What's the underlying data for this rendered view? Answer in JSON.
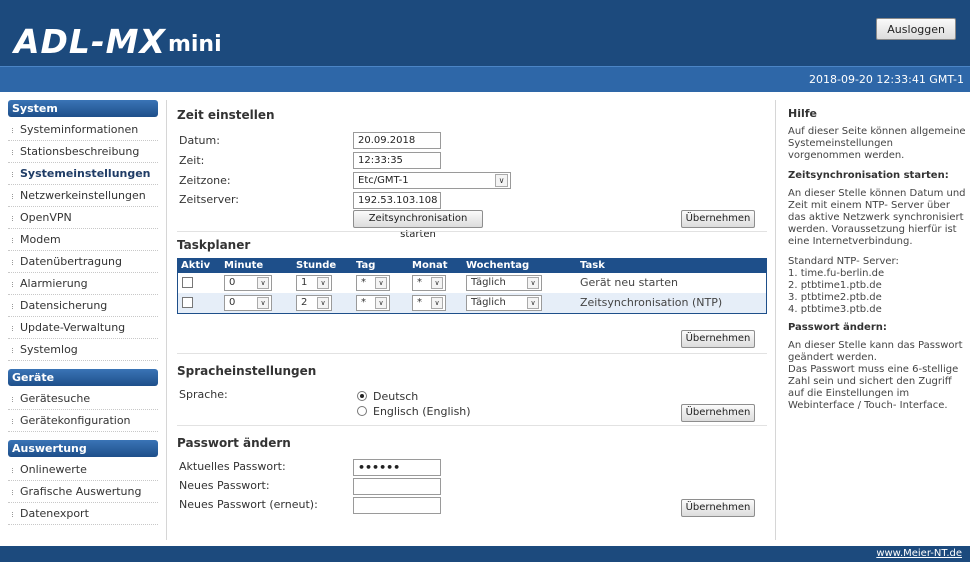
{
  "header": {
    "logo_main": "ADL-MX",
    "logo_sub": "mini",
    "logout_label": "Ausloggen",
    "datetime": "2018-09-20 12:33:41 GMT-1"
  },
  "sidebar": {
    "groups": [
      {
        "title": "System",
        "items": [
          "Systeminformationen",
          "Stationsbeschreibung",
          "Systemeinstellungen",
          "Netzwerkeinstellungen",
          "OpenVPN",
          "Modem",
          "Datenübertragung",
          "Alarmierung",
          "Datensicherung",
          "Update-Verwaltung",
          "Systemlog"
        ]
      },
      {
        "title": "Geräte",
        "items": [
          "Gerätesuche",
          "Gerätekonfiguration"
        ]
      },
      {
        "title": "Auswertung",
        "items": [
          "Onlinewerte",
          "Grafische Auswertung",
          "Datenexport"
        ]
      }
    ],
    "active_item": "Systemeinstellungen"
  },
  "time_section": {
    "title": "Zeit einstellen",
    "date_label": "Datum:",
    "date_value": "20.09.2018",
    "time_label": "Zeit:",
    "time_value": "12:33:35",
    "timezone_label": "Zeitzone:",
    "timezone_value": "Etc/GMT-1",
    "server_label": "Zeitserver:",
    "server_value": "192.53.103.108",
    "sync_button": "Zeitsynchronisation starten",
    "apply_button": "Übernehmen"
  },
  "task_section": {
    "title": "Taskplaner",
    "columns": [
      "Aktiv",
      "Minute",
      "Stunde",
      "Tag",
      "Monat",
      "Wochentag",
      "Task"
    ],
    "rows": [
      {
        "minute": "0",
        "hour": "1",
        "day": "*",
        "month": "*",
        "weekday": "Täglich",
        "task": "Gerät neu starten"
      },
      {
        "minute": "0",
        "hour": "2",
        "day": "*",
        "month": "*",
        "weekday": "Täglich",
        "task": "Zeitsynchronisation (NTP)"
      }
    ],
    "apply_button": "Übernehmen"
  },
  "lang_section": {
    "title": "Spracheinstellungen",
    "label": "Sprache:",
    "options": [
      "Deutsch",
      "Englisch (English)"
    ],
    "selected": "Deutsch",
    "apply_button": "Übernehmen"
  },
  "pw_section": {
    "title": "Passwort ändern",
    "current_label": "Aktuelles Passwort:",
    "current_value": "••••••",
    "new_label": "Neues Passwort:",
    "repeat_label": "Neues Passwort (erneut):",
    "apply_button": "Übernehmen"
  },
  "help": {
    "title": "Hilfe",
    "intro": "Auf dieser Seite können allgemeine Systemeinstellungen vorgenommen werden.",
    "sync_title": "Zeitsynchronisation starten:",
    "sync_text": "An dieser Stelle können Datum und Zeit mit einem NTP- Server über das aktive Netzwerk synchronisiert werden. Voraussetzung hierfür ist eine Internetverbindung.",
    "ntp_heading": "Standard NTP- Server:",
    "ntp_servers": [
      "1. time.fu-berlin.de",
      "2. ptbtime1.ptb.de",
      "3. ptbtime2.ptb.de",
      "4. ptbtime3.ptb.de"
    ],
    "pw_title": "Passwort ändern:",
    "pw_text": "An dieser Stelle kann das Passwort geändert werden.",
    "pw_text2": "Das Passwort muss eine 6-stellige Zahl sein und sichert den Zugriff auf die Einstellungen im Webinterface / Touch- Interface."
  },
  "footer": {
    "link": "www.Meier-NT.de"
  }
}
